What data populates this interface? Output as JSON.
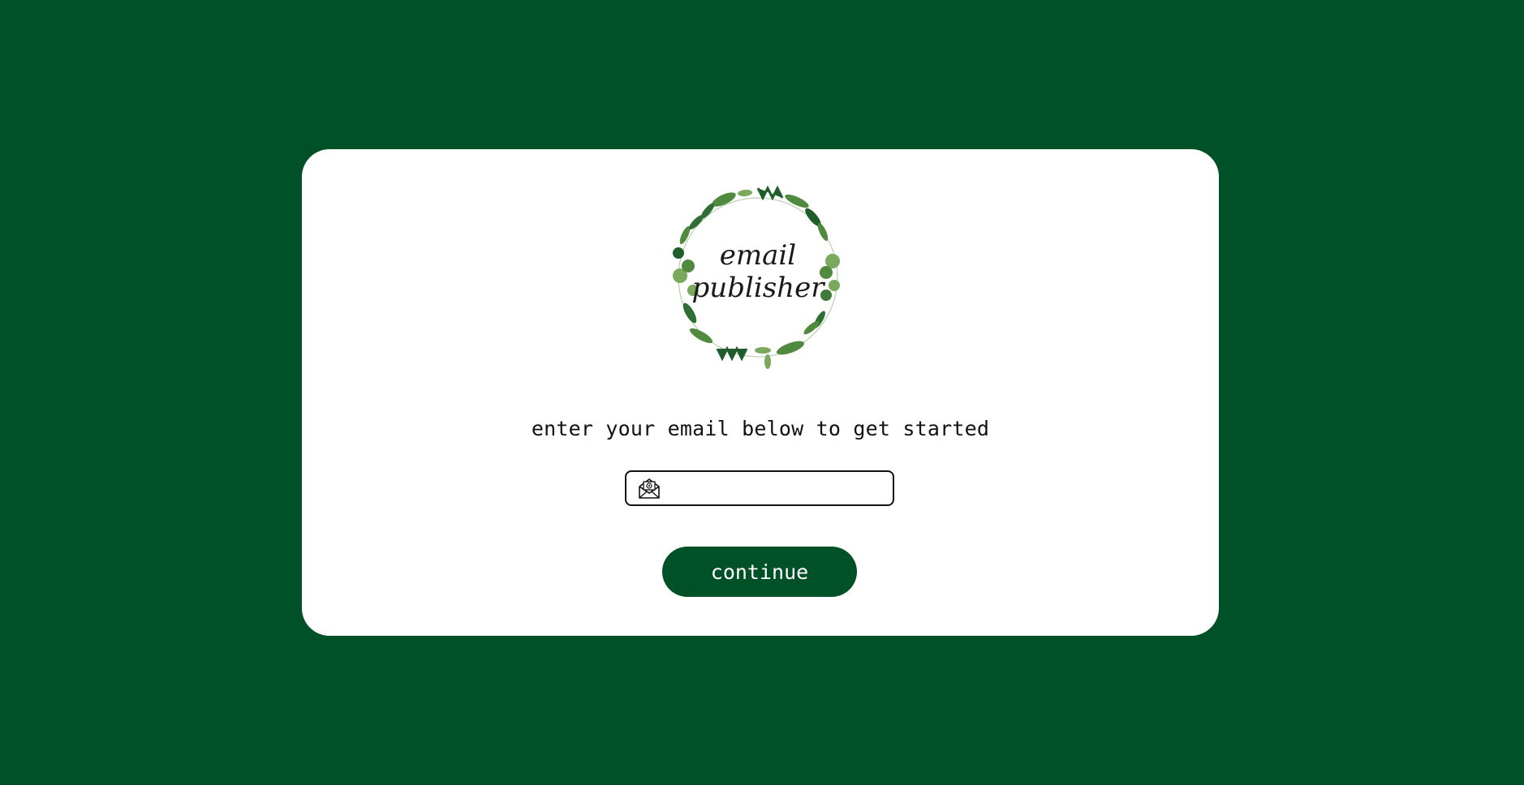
{
  "logo": {
    "line1": "email",
    "line2": "publisher"
  },
  "prompt_text": "enter your email below to get started",
  "email_input": {
    "value": "",
    "placeholder": ""
  },
  "continue_label": "continue",
  "colors": {
    "background": "#005127",
    "card": "#ffffff",
    "button": "#005127",
    "leaf_dark": "#1f5e2c",
    "leaf_light": "#7aa95c"
  },
  "icons": {
    "email": "envelope-at-icon",
    "logo": "leaf-wreath-logo"
  }
}
